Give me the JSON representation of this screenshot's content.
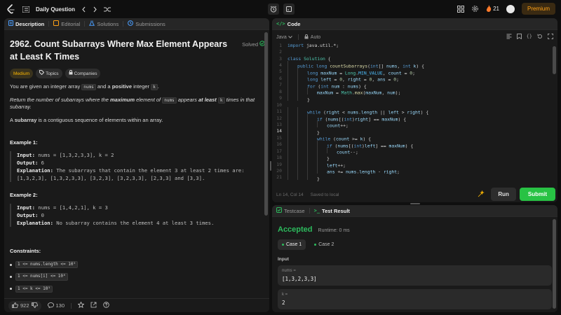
{
  "topbar": {
    "title": "Daily Question",
    "streak": "21",
    "premium": "Premium"
  },
  "left_tabs": [
    {
      "label": "Description"
    },
    {
      "label": "Editorial"
    },
    {
      "label": "Solutions"
    },
    {
      "label": "Submissions"
    }
  ],
  "problem": {
    "title": "2962. Count Subarrays Where Max Element Appears at Least K Times",
    "solved": "Solved",
    "difficulty": "Medium",
    "topics": "Topics",
    "companies": "Companies",
    "p1": {
      "a": "You are given an integer array ",
      "code": "nums",
      "b": " and a ",
      "bold": "positive",
      "c": " integer ",
      "code2": "k",
      "d": "."
    },
    "p2": {
      "a": "Return the number of subarrays where the ",
      "bold": "maximum",
      "b": " element of ",
      "code": "nums",
      "c": " appears ",
      "bold2": "at least",
      "code2": "k",
      "d": " times in that subarray."
    },
    "p3": {
      "bold": "subarray",
      "rest": " is a contiguous sequence of elements within an array.",
      "a": "A "
    },
    "examples": [
      {
        "title": "Example 1:",
        "input_label": "Input:",
        "input": "nums = [1,3,2,3,3], k = 2",
        "output_label": "Output:",
        "output": "6",
        "expl_label": "Explanation:",
        "expl": "The subarrays that contain the element 3 at least 2 times are:",
        "expl2": "[1,3,2,3], [1,3,2,3,3], [3,2,3], [3,2,3,3], [2,3,3] and [3,3]."
      },
      {
        "title": "Example 2:",
        "input_label": "Input:",
        "input": "nums = [1,4,2,1], k = 3",
        "output_label": "Output:",
        "output": "0",
        "expl_label": "Explanation:",
        "expl": "No subarray contains the element 4 at least 3 times."
      }
    ],
    "constraints_title": "Constraints:",
    "constraints": [
      "1 <= nums.length <= 10⁵",
      "1 <= nums[i] <= 10⁶",
      "1 <= k <= 10⁵"
    ]
  },
  "bottom": {
    "likes": "922",
    "comments": "130"
  },
  "code_panel": {
    "tab": "Code",
    "language": "Java",
    "auto": "Auto",
    "status": "Ln 14, Col 14",
    "saved": "Saved to local",
    "run": "Run",
    "submit": "Submit"
  },
  "result_panel": {
    "tab1": "Testcase",
    "tab2": "Test Result",
    "verdict": "Accepted",
    "runtime": "Runtime: 0 ms",
    "cases": [
      "Case 1",
      "Case 2"
    ],
    "input_label": "Input",
    "inputs": [
      {
        "key": "nums =",
        "value": "[1,3,2,3,3]"
      },
      {
        "key": "k =",
        "value": "2"
      }
    ]
  },
  "colors": {
    "accent": "#ffa116",
    "accepted": "#2cbb5d",
    "submit": "#28c244",
    "medium": "#ffb800"
  }
}
